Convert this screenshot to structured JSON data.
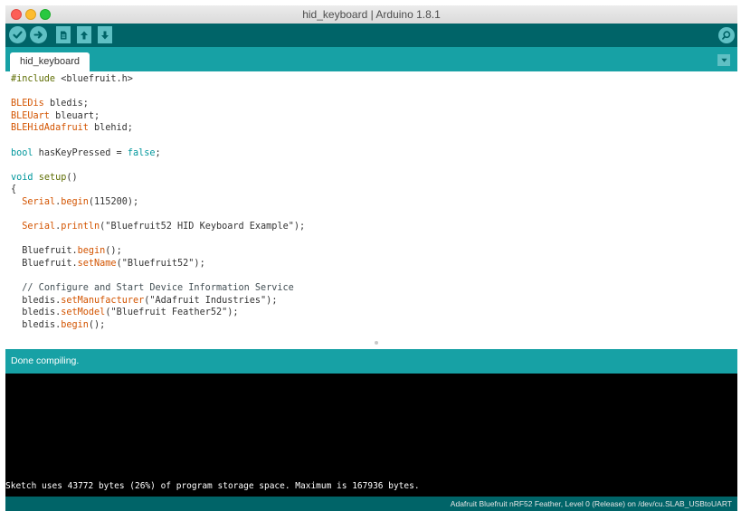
{
  "window": {
    "title": "hid_keyboard | Arduino 1.8.1"
  },
  "toolbar": {
    "verify_icon": "checkmark-icon",
    "upload_icon": "arrow-right-icon",
    "new_icon": "document-icon",
    "open_icon": "arrow-up-icon",
    "save_icon": "arrow-down-icon",
    "serial_icon": "magnifier-icon"
  },
  "tabs": [
    {
      "label": "hid_keyboard"
    }
  ],
  "code": {
    "line01": {
      "pre": "#include",
      "text": " <bluefruit.h>"
    },
    "line03": {
      "type": "BLEDis",
      "text": " bledis;"
    },
    "line04": {
      "type": "BLEUart",
      "text": " bleuart;"
    },
    "line05": {
      "type": "BLEHidAdafruit",
      "text": " blehid;"
    },
    "line07": {
      "type": "bool",
      "text1": " hasKeyPressed = ",
      "val": "false",
      "text2": ";"
    },
    "line09": {
      "type": "void",
      "fn": "setup",
      "text": "()"
    },
    "line10": {
      "text": "{"
    },
    "line11": {
      "indent": "  ",
      "obj": "Serial",
      "dot": ".",
      "fn": "begin",
      "text": "(115200);"
    },
    "line13": {
      "indent": "  ",
      "obj": "Serial",
      "dot": ".",
      "fn": "println",
      "text": "(\"Bluefruit52 HID Keyboard Example\");"
    },
    "line15": {
      "indent": "  ",
      "obj": "Bluefruit",
      "dot": ".",
      "fn": "begin",
      "text": "();"
    },
    "line16": {
      "indent": "  ",
      "obj": "Bluefruit",
      "dot": ".",
      "fn": "setName",
      "text": "(\"Bluefruit52\");"
    },
    "line18": {
      "indent": "  ",
      "comment": "// Configure and Start Device Information Service"
    },
    "line19": {
      "indent": "  ",
      "obj": "bledis",
      "dot": ".",
      "fn": "setManufacturer",
      "text": "(\"Adafruit Industries\");"
    },
    "line20": {
      "indent": "  ",
      "obj": "bledis",
      "dot": ".",
      "fn": "setModel",
      "text": "(\"Bluefruit Feather52\");"
    },
    "line21": {
      "indent": "  ",
      "obj": "bledis",
      "dot": ".",
      "fn": "begin",
      "text": "();"
    }
  },
  "status": {
    "message": "Done compiling."
  },
  "console": {
    "output": "Sketch uses 43772 bytes (26%) of program storage space. Maximum is 167936 bytes."
  },
  "footer": {
    "board": "Adafruit Bluefruit nRF52 Feather, Level 0 (Release) on /dev/cu.SLAB_USBtoUART"
  },
  "colors": {
    "toolbar": "#006468",
    "accent": "#17a1a5",
    "button": "#5fc0c4",
    "keyword": "#d35400",
    "primitive": "#00979c"
  }
}
